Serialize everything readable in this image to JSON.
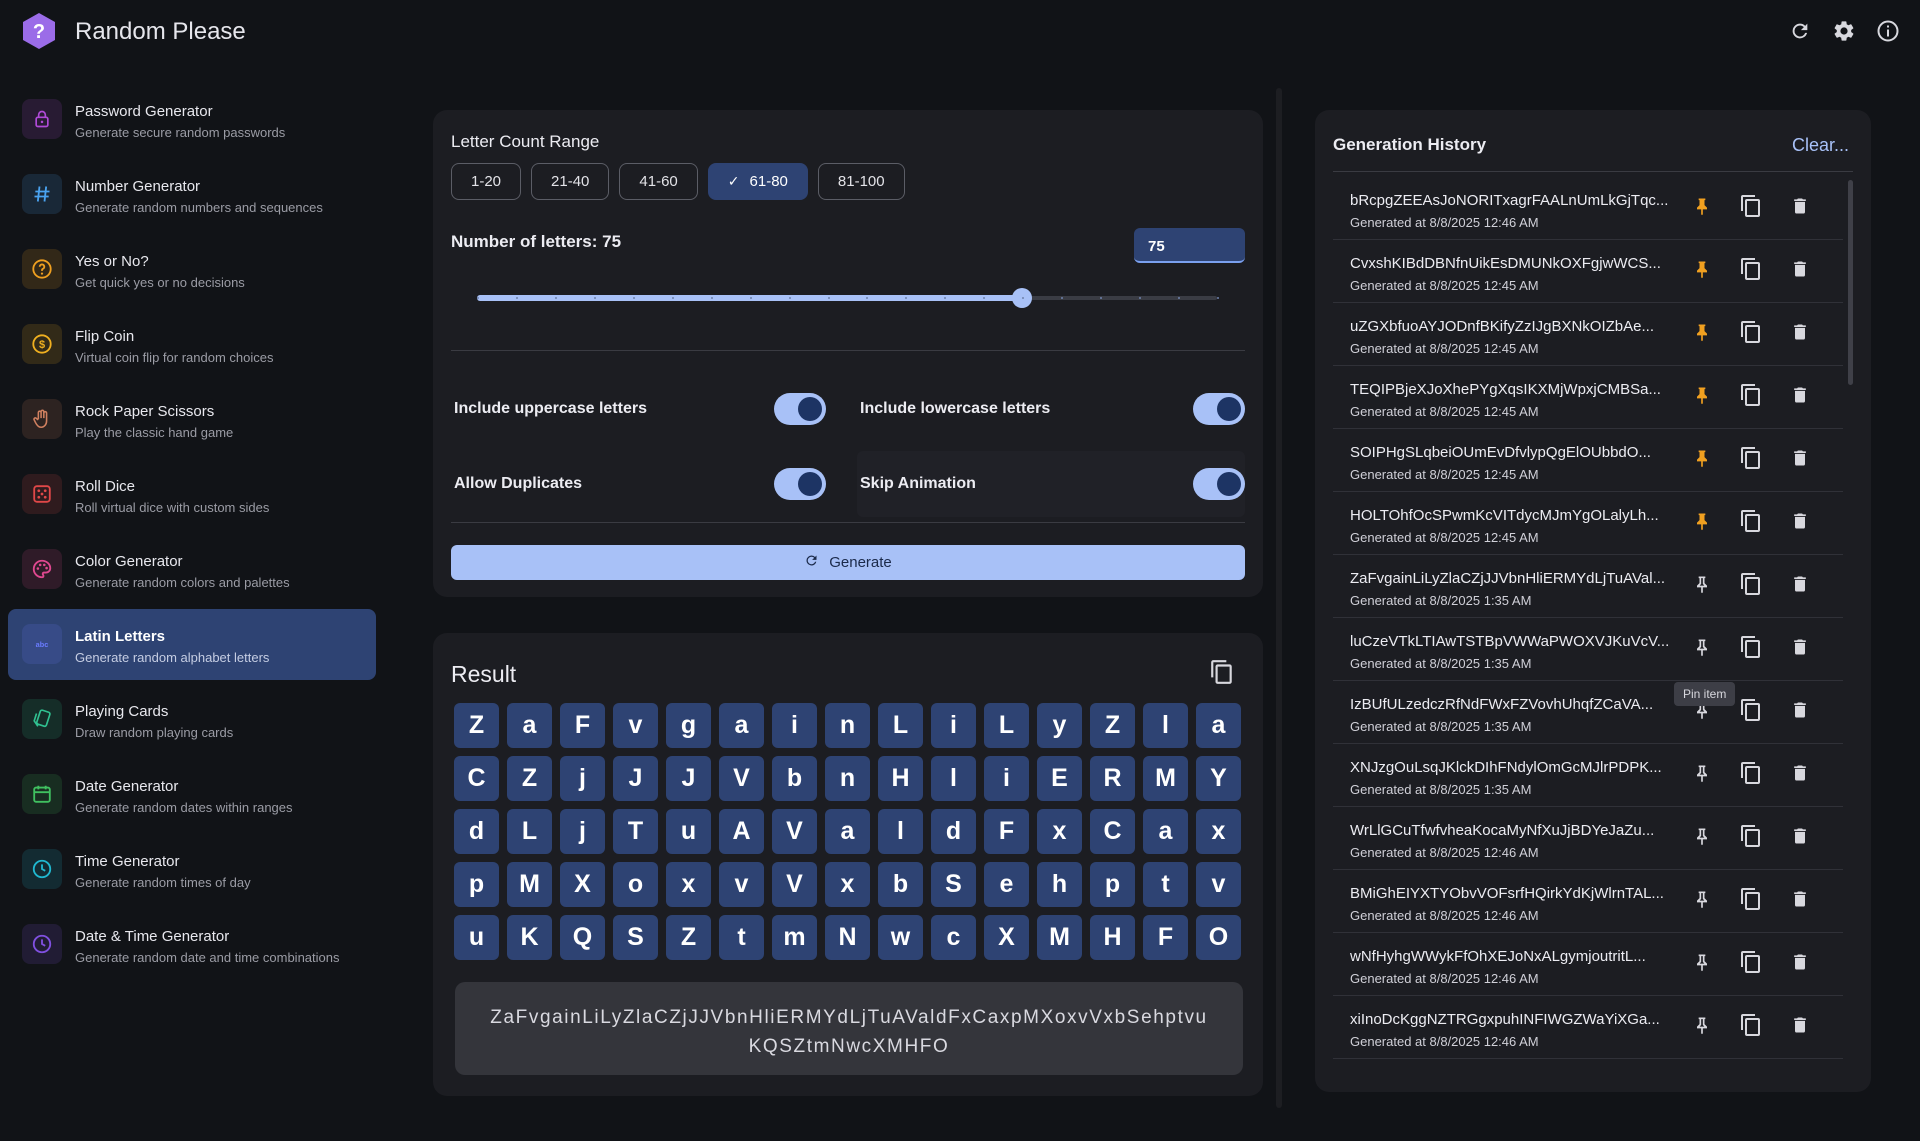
{
  "app": {
    "title": "Random Please"
  },
  "header_icons": [
    "refresh-icon",
    "settings-icon",
    "info-icon"
  ],
  "sidebar": {
    "items": [
      {
        "title": "Password Generator",
        "subtitle": "Generate secure random passwords",
        "icon": "lock-icon",
        "color": "#b04ad8"
      },
      {
        "title": "Number Generator",
        "subtitle": "Generate random numbers and sequences",
        "icon": "hash-icon",
        "color": "#4aa3f0"
      },
      {
        "title": "Yes or No?",
        "subtitle": "Get quick yes or no decisions",
        "icon": "question-circle-icon",
        "color": "#f0a020"
      },
      {
        "title": "Flip Coin",
        "subtitle": "Virtual coin flip for random choices",
        "icon": "coin-icon",
        "color": "#f0b020"
      },
      {
        "title": "Rock Paper Scissors",
        "subtitle": "Play the classic hand game",
        "icon": "hand-icon",
        "color": "#d08060"
      },
      {
        "title": "Roll Dice",
        "subtitle": "Roll virtual dice with custom sides",
        "icon": "dice-icon",
        "color": "#e04848"
      },
      {
        "title": "Color Generator",
        "subtitle": "Generate random colors and palettes",
        "icon": "palette-icon",
        "color": "#e04890"
      },
      {
        "title": "Latin Letters",
        "subtitle": "Generate random alphabet letters",
        "icon": "abc-icon",
        "color": "#6a7cff",
        "active": true
      },
      {
        "title": "Playing Cards",
        "subtitle": "Draw random playing cards",
        "icon": "cards-icon",
        "color": "#30c090"
      },
      {
        "title": "Date Generator",
        "subtitle": "Generate random dates within ranges",
        "icon": "calendar-icon",
        "color": "#40c060"
      },
      {
        "title": "Time Generator",
        "subtitle": "Generate random times of day",
        "icon": "clock-icon",
        "color": "#20b8d0"
      },
      {
        "title": "Date & Time Generator",
        "subtitle": "Generate random date and time combinations",
        "icon": "clock-icon",
        "color": "#8050e0"
      }
    ]
  },
  "settings": {
    "range_label": "Letter Count Range",
    "ranges": [
      "1-20",
      "21-40",
      "41-60",
      "61-80",
      "81-100"
    ],
    "selected_range": "61-80",
    "count_label": "Number of letters: 75",
    "count_value": "75",
    "slider": {
      "min": 61,
      "max": 80,
      "value": 75,
      "fraction": 0.737
    },
    "options": [
      {
        "label": "Include uppercase letters",
        "on": true
      },
      {
        "label": "Include lowercase letters",
        "on": true
      },
      {
        "label": "Allow Duplicates",
        "on": true
      },
      {
        "label": "Skip Animation",
        "on": true
      }
    ],
    "generate_label": "Generate"
  },
  "result": {
    "title": "Result",
    "letters": [
      "Z",
      "a",
      "F",
      "v",
      "g",
      "a",
      "i",
      "n",
      "L",
      "i",
      "L",
      "y",
      "Z",
      "l",
      "a",
      "C",
      "Z",
      "j",
      "J",
      "J",
      "V",
      "b",
      "n",
      "H",
      "l",
      "i",
      "E",
      "R",
      "M",
      "Y",
      "d",
      "L",
      "j",
      "T",
      "u",
      "A",
      "V",
      "a",
      "l",
      "d",
      "F",
      "x",
      "C",
      "a",
      "x",
      "p",
      "M",
      "X",
      "o",
      "x",
      "v",
      "V",
      "x",
      "b",
      "S",
      "e",
      "h",
      "p",
      "t",
      "v",
      "u",
      "K",
      "Q",
      "S",
      "Z",
      "t",
      "m",
      "N",
      "w",
      "c",
      "X",
      "M",
      "H",
      "F",
      "O"
    ],
    "text_line1": "ZaFvgainLiLyZlaCZjJJVbnHliERMYdLjTuAValdFxCaxpMXoxvVxbSehptvu",
    "text_line2": "KQSZtmNwcXMHFO"
  },
  "history": {
    "title": "Generation History",
    "clear_label": "Clear...",
    "tooltip": "Pin item",
    "items": [
      {
        "text": "bRcpgZEEAsJoNORITxagrFAALnUmLkGjTqc...",
        "date": "Generated at 8/8/2025 12:46 AM",
        "pinned": true
      },
      {
        "text": "CvxshKIBdDBNfnUikEsDMUNkOXFgjwWCS...",
        "date": "Generated at 8/8/2025 12:45 AM",
        "pinned": true
      },
      {
        "text": "uZGXbfuoAYJODnfBKifyZzIJgBXNkOIZbAe...",
        "date": "Generated at 8/8/2025 12:45 AM",
        "pinned": true
      },
      {
        "text": "TEQIPBjeXJoXhePYgXqsIKXMjWpxjCMBSa...",
        "date": "Generated at 8/8/2025 12:45 AM",
        "pinned": true
      },
      {
        "text": "SOIPHgSLqbeiOUmEvDfvlypQgElOUbbdO...",
        "date": "Generated at 8/8/2025 12:45 AM",
        "pinned": true
      },
      {
        "text": "HOLTOhfOcSPwmKcVITdycMJmYgOLalyLh...",
        "date": "Generated at 8/8/2025 12:45 AM",
        "pinned": true
      },
      {
        "text": "ZaFvgainLiLyZlaCZjJJVbnHliERMYdLjTuAVal...",
        "date": "Generated at 8/8/2025 1:35 AM",
        "pinned": false
      },
      {
        "text": "luCzeVTkLTIAwTSTBpVWWaPWOXVJKuVcV...",
        "date": "Generated at 8/8/2025 1:35 AM",
        "pinned": false
      },
      {
        "text": "IzBUfULzedczRfNdFWxFZVovhUhqfZCaVA...",
        "date": "Generated at 8/8/2025 1:35 AM",
        "pinned": false
      },
      {
        "text": "XNJzgOuLsqJKlckDIhFNdylOmGcMJlrPDPK...",
        "date": "Generated at 8/8/2025 1:35 AM",
        "pinned": false
      },
      {
        "text": "WrLlGCuTfwfvheaKocaMyNfXuJjBDYeJaZu...",
        "date": "Generated at 8/8/2025 12:46 AM",
        "pinned": false
      },
      {
        "text": "BMiGhEIYXTYObvVOFsrfHQirkYdKjWlrnTAL...",
        "date": "Generated at 8/8/2025 12:46 AM",
        "pinned": false
      },
      {
        "text": "wNfHyhgWWykFfOhXEJoNxALgymjoutritL...",
        "date": "Generated at 8/8/2025 12:46 AM",
        "pinned": false
      },
      {
        "text": "xiInoDcKggNZTRGgxpuhINFIWGZWaYiXGa...",
        "date": "Generated at 8/8/2025 12:46 AM",
        "pinned": false
      }
    ]
  },
  "colors": {
    "accent": "#a8c1f7",
    "selected": "#2e4373",
    "pin_active": "#f0a020"
  }
}
